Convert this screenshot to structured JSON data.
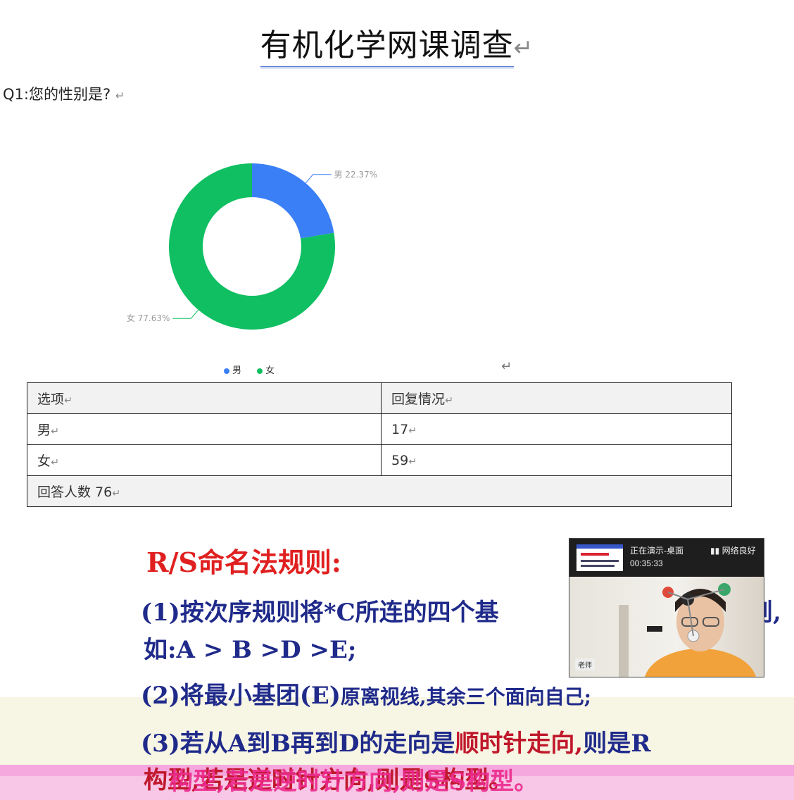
{
  "document": {
    "title": "有机化学网课调查",
    "question": "Q1:您的性别是?",
    "return_mark": "↵"
  },
  "chart_data": {
    "type": "pie",
    "subtype": "donut",
    "slices": [
      {
        "label": "男",
        "value": 22.37,
        "color": "#3a7ff6"
      },
      {
        "label": "女",
        "value": 77.63,
        "color": "#0fbf62"
      }
    ],
    "slice_labels": [
      "男 22.37%",
      "女 77.63%"
    ],
    "legend": [
      "男",
      "女"
    ],
    "legend_placement": "bottom"
  },
  "table": {
    "header": [
      "选项",
      "回复情况"
    ],
    "rows": [
      [
        "男",
        "17"
      ],
      [
        "女",
        "59"
      ]
    ],
    "footer": "回答人数 76"
  },
  "slide": {
    "title": "R/S命名法规则:",
    "rule1_a": "(1)按次序规则将*C所连的四个基",
    "rule1_b": "则,",
    "rule1_c": "如:A > B >D >E;",
    "rule2": "(2)将最小基团(E)",
    "rule2_b": "原离视线,其余三个面向自己;",
    "rule3_a": "(3)若从A到B再到D的走向是",
    "rule3_red": "顺时针走向,",
    "rule3_b": "则是R",
    "rule3_c": "构型,若是逆时针方向,则是S构型。",
    "overlay": "构型,若是逆时针方向,则是S构型。"
  },
  "video": {
    "status_line1": "正在演示-桌面",
    "status_line2": "00:35:33",
    "network": "网络良好",
    "name_tag": "老师"
  }
}
